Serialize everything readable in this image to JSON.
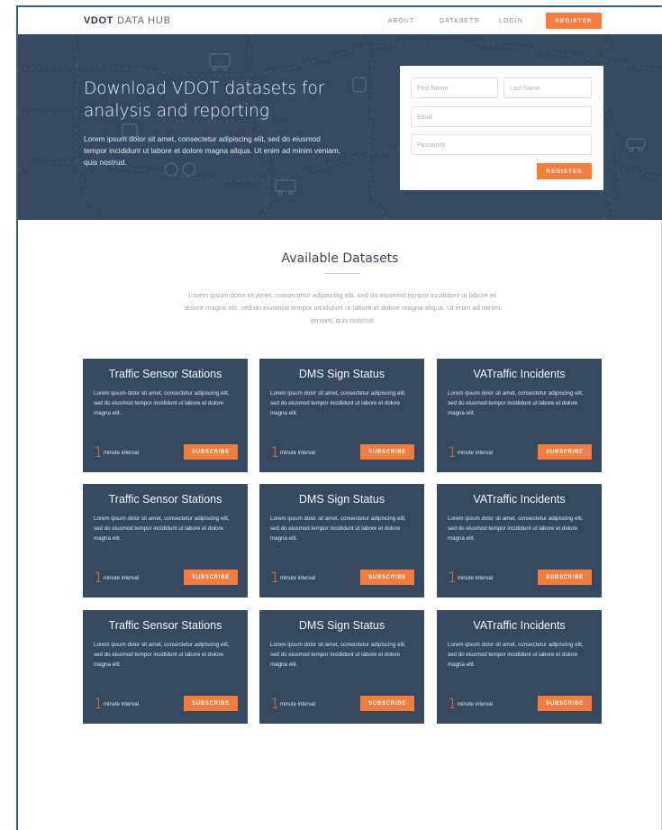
{
  "nav": {
    "logo_mark": "VDOT",
    "logo_text": "DATA HUB",
    "links": [
      "ABOUT",
      "DATASETS",
      "LOGIN"
    ],
    "register_label": "REGISTER"
  },
  "hero": {
    "title": "Download VDOT datasets for analysis and reporting",
    "text": "Lorem ipsum dolor sit amet, consectetur adipiscing elit, sed do eiusmod tempor incididunt ut labore et dolore magna aliqua. Ut enim ad minim veniam, quis nostrud.",
    "form": {
      "first_name_placeholder": "First Name",
      "last_name_placeholder": "Last Name",
      "email_placeholder": "Email",
      "password_placeholder": "Password",
      "register_label": "REGISTER"
    }
  },
  "datasets": {
    "title": "Available Datasets",
    "text": "Lorem ipsum dolor sit amet, consectetur adipiscing elit, sed do eiusmod tempor incididunt ut labore et dolore magna elit, sed do eiusmod tempor incididunt ut labore et dolore magna aliqua. Ut enim ad minim veniam, quis nostrud.",
    "cards": [
      {
        "title": "Traffic Sensor Stations",
        "desc": "Lorem ipsum dolor sit amet, consectetur adipiscing elit, sed do eiusmod tempor incididunt ut labore et dolore magna elit.",
        "interval": "1",
        "unit": "minute interval",
        "button": "SUBSCRIBE"
      },
      {
        "title": "DMS Sign Status",
        "desc": "Lorem ipsum dolor sit amet, consectetur adipiscing elit, sed do eiusmod tempor incididunt ut labore et dolore magna elit.",
        "interval": "1",
        "unit": "minute interval",
        "button": "SUBSCRIBE"
      },
      {
        "title": "VATraffic Incidents",
        "desc": "Lorem ipsum dolor sit amet, consectetur adipiscing elit, sed do eiusmod tempor incididunt ut labore et dolore magna elit.",
        "interval": "1",
        "unit": "minute interval",
        "button": "SUBSCRIBE"
      },
      {
        "title": "Traffic Sensor Stations",
        "desc": "Lorem ipsum dolor sit amet, consectetur adipiscing elit, sed do eiusmod tempor incididunt ut labore et dolore magna elit.",
        "interval": "1",
        "unit": "minute interval",
        "button": "SUBSCRIBE"
      },
      {
        "title": "DMS Sign Status",
        "desc": "Lorem ipsum dolor sit amet, consectetur adipiscing elit, sed do eiusmod tempor incididunt ut labore et dolore magna elit.",
        "interval": "1",
        "unit": "minute interval",
        "button": "SUBSCRIBE"
      },
      {
        "title": "VATraffic Incidents",
        "desc": "Lorem ipsum dolor sit amet, consectetur adipiscing elit, sed do eiusmod tempor incididunt ut labore et dolore magna elit.",
        "interval": "1",
        "unit": "minute interval",
        "button": "SUBSCRIBE"
      },
      {
        "title": "Traffic Sensor Stations",
        "desc": "Lorem ipsum dolor sit amet, consectetur adipiscing elit, sed do eiusmod tempor incididunt ut labore et dolore magna elit.",
        "interval": "1",
        "unit": "minute interval",
        "button": "SUBSCRIBE"
      },
      {
        "title": "DMS Sign Status",
        "desc": "Lorem ipsum dolor sit amet, consectetur adipiscing elit, sed do eiusmod tempor incididunt ut labore et dolore magna elit.",
        "interval": "1",
        "unit": "minute interval",
        "button": "SUBSCRIBE"
      },
      {
        "title": "VATraffic Incidents",
        "desc": "Lorem ipsum dolor sit amet, consectetur adipiscing elit, sed do eiusmod tempor incididunt ut labore et dolore magna elit.",
        "interval": "1",
        "unit": "minute interval",
        "button": "SUBSCRIBE"
      }
    ]
  },
  "colors": {
    "accent": "#f47c3c",
    "dark": "#36495e"
  }
}
